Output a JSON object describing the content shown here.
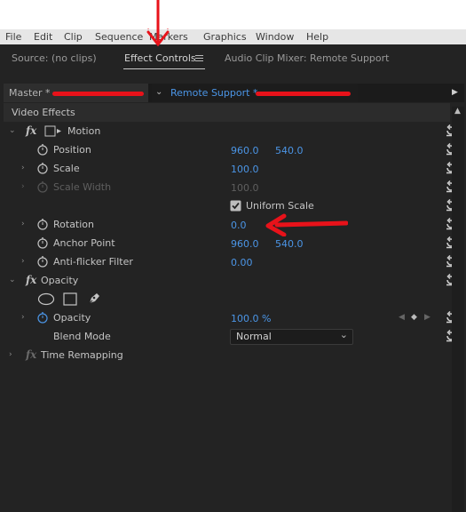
{
  "menu": [
    "File",
    "Edit",
    "Clip",
    "Sequence",
    "Markers",
    "Graphics",
    "Window",
    "Help"
  ],
  "tabs": {
    "source": "Source: (no clips)",
    "effect_controls": "Effect Controls",
    "audio_mixer": "Audio Clip Mixer: Remote Support"
  },
  "clip": {
    "master": "Master *",
    "sequence": "Remote Support *"
  },
  "section": "Video Effects",
  "motion": {
    "title": "Motion",
    "position": {
      "label": "Position",
      "x": "960.0",
      "y": "540.0"
    },
    "scale": {
      "label": "Scale",
      "value": "100.0"
    },
    "scale_width": {
      "label": "Scale Width",
      "value": "100.0"
    },
    "uniform_scale": "Uniform Scale",
    "rotation": {
      "label": "Rotation",
      "value": "0.0"
    },
    "anchor_point": {
      "label": "Anchor Point",
      "x": "960.0",
      "y": "540.0"
    },
    "anti_flicker": {
      "label": "Anti-flicker Filter",
      "value": "0.00"
    }
  },
  "opacity": {
    "title": "Opacity",
    "opacity": {
      "label": "Opacity",
      "value": "100.0 %"
    },
    "blend_mode": {
      "label": "Blend Mode",
      "value": "Normal"
    }
  },
  "time_remapping": "Time Remapping",
  "colors": {
    "value_blue": "#4b95e6",
    "annotation_red": "#e8121a"
  }
}
